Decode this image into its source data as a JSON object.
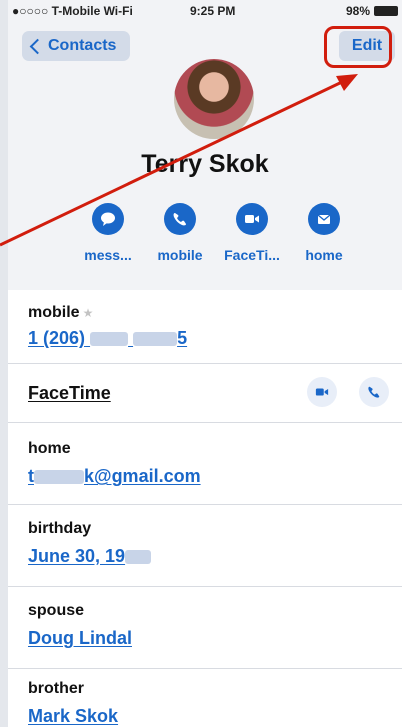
{
  "status": {
    "carrier": "●○○○○ T-Mobile Wi-Fi",
    "time": "9:25 PM",
    "battery": "98%"
  },
  "nav": {
    "back_label": "Contacts",
    "edit_label": "Edit"
  },
  "contact": {
    "name": "Terry Skok"
  },
  "actions": [
    {
      "label": "mess...",
      "icon": "message-icon"
    },
    {
      "label": "mobile",
      "icon": "phone-icon"
    },
    {
      "label": "FaceTi...",
      "icon": "video-icon"
    },
    {
      "label": "home",
      "icon": "mail-icon"
    }
  ],
  "fields": {
    "mobile": {
      "label": "mobile",
      "value_prefix": "1 (206)",
      "value_suffix": "5"
    },
    "facetime": {
      "label": "FaceTime"
    },
    "email": {
      "label": "home",
      "value_prefix": "t",
      "value_suffix": "k@gmail.com"
    },
    "birthday": {
      "label": "birthday",
      "value_prefix": "June 30, 19"
    },
    "spouse": {
      "label": "spouse",
      "value": "Doug Lindal"
    },
    "brother": {
      "label": "brother",
      "value": "Mark Skok"
    }
  },
  "colors": {
    "accent": "#1a67c8",
    "annotation": "#d11d0d"
  }
}
